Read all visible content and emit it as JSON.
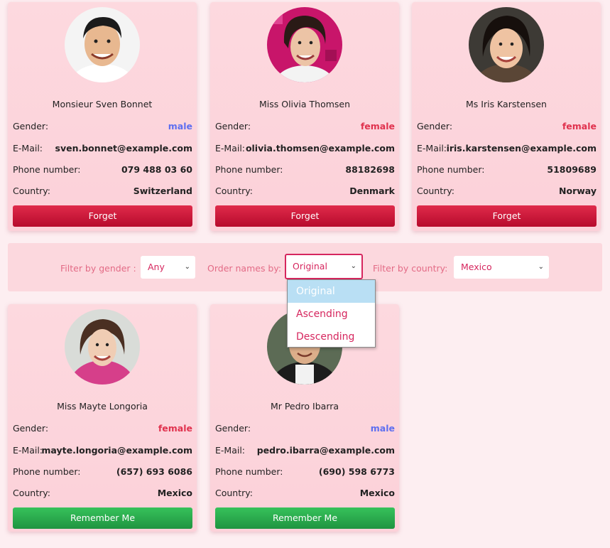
{
  "cards_top": [
    {
      "name": "Monsieur Sven Bonnet",
      "gender": "male",
      "email": "sven.bonnet@example.com",
      "phone": "079 488 03 60",
      "country": "Switzerland",
      "action": "Forget"
    },
    {
      "name": "Miss Olivia Thomsen",
      "gender": "female",
      "email": "olivia.thomsen@example.com",
      "phone": "88182698",
      "country": "Denmark",
      "action": "Forget"
    },
    {
      "name": "Ms Iris Karstensen",
      "gender": "female",
      "email": "iris.karstensen@example.com",
      "phone": "51809689",
      "country": "Norway",
      "action": "Forget"
    }
  ],
  "cards_bottom": [
    {
      "name": "Miss Mayte Longoria",
      "gender": "female",
      "email": "mayte.longoria@example.com",
      "phone": "(657) 693 6086",
      "country": "Mexico",
      "action": "Remember Me"
    },
    {
      "name": "Mr Pedro Ibarra",
      "gender": "male",
      "email": "pedro.ibarra@example.com",
      "phone": "(690) 598 6773",
      "country": "Mexico",
      "action": "Remember Me"
    }
  ],
  "labels": {
    "gender": "Gender:",
    "email": "E-Mail:",
    "phone": "Phone number:",
    "country": "Country:"
  },
  "filters": {
    "gender_label": "Filter by gender :",
    "gender_value": "Any",
    "order_label": "Order names by:",
    "order_value": "Original",
    "country_label": "Filter by country:",
    "country_value": "Mexico",
    "order_options": [
      "Original",
      "Ascending",
      "Descending"
    ]
  },
  "colors": {
    "male": "#5e6ff0",
    "female": "#e0324e",
    "forget": "#d11d3e",
    "remember": "#2aa84c",
    "accent": "#d6265e"
  }
}
